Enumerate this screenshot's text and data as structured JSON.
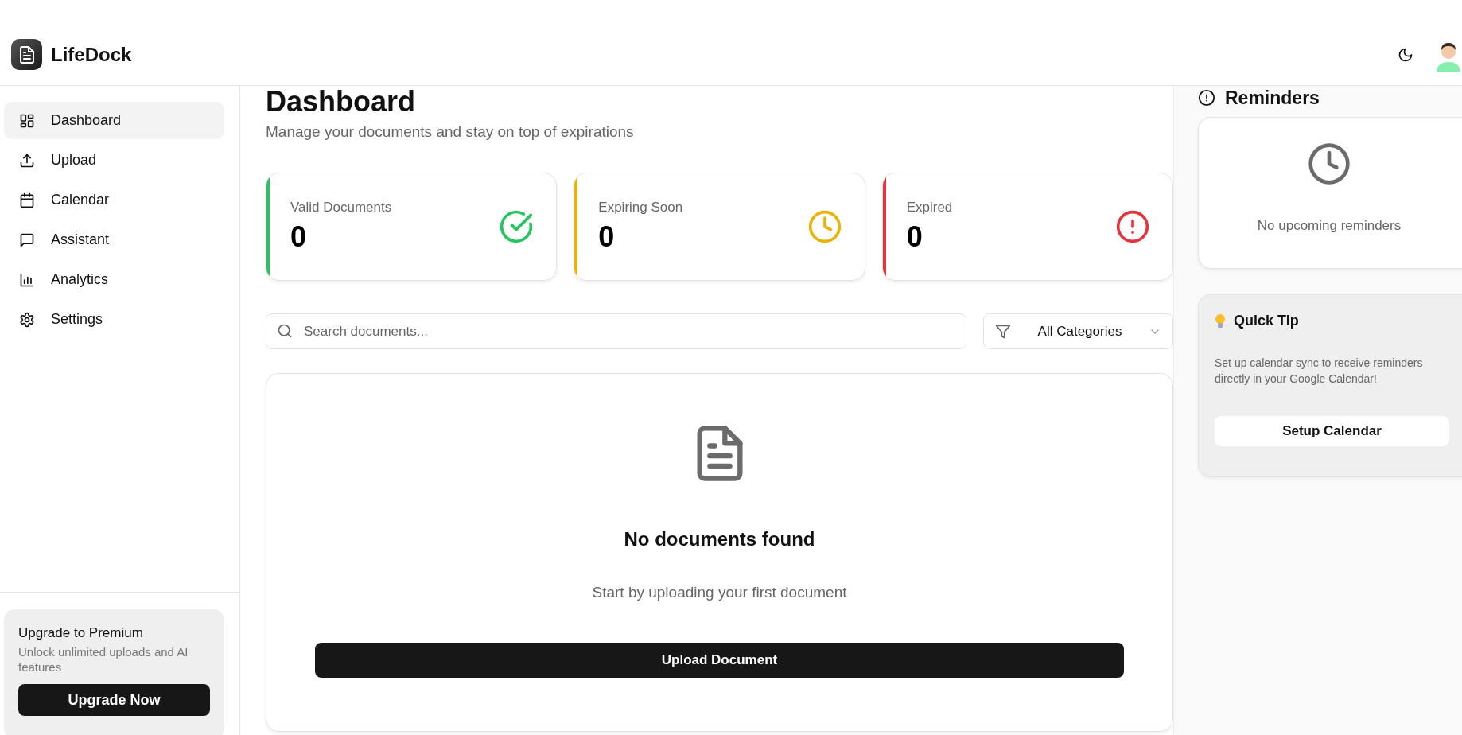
{
  "app": {
    "name": "LifeDock"
  },
  "sidebar": {
    "items": [
      {
        "label": "Dashboard",
        "kind": "grid",
        "selected": true
      },
      {
        "label": "Upload",
        "kind": "upload",
        "selected": false
      },
      {
        "label": "Calendar",
        "kind": "calendar",
        "selected": false
      },
      {
        "label": "Assistant",
        "kind": "chat",
        "selected": false
      },
      {
        "label": "Analytics",
        "kind": "chart",
        "selected": false
      },
      {
        "label": "Settings",
        "kind": "gear",
        "selected": false
      }
    ],
    "premium": {
      "title": "Upgrade to Premium",
      "text": "Unlock unlimited uploads and AI features",
      "button": "Upgrade Now"
    }
  },
  "page": {
    "title": "Dashboard",
    "subtitle": "Manage your documents and stay on top of expirations"
  },
  "stats": [
    {
      "label": "Valid Documents",
      "value": "0",
      "kind": "check",
      "color": "#22c55e"
    },
    {
      "label": "Expiring Soon",
      "value": "0",
      "kind": "clock",
      "color": "#eab308"
    },
    {
      "label": "Expired",
      "value": "0",
      "kind": "alert",
      "color": "#e5343d"
    }
  ],
  "search": {
    "placeholder": "Search documents..."
  },
  "category_filter": {
    "value": "All Categories"
  },
  "empty_state": {
    "title": "No documents found",
    "text": "Start by uploading your first document",
    "button": "Upload Document"
  },
  "reminders": {
    "title": "Reminders",
    "empty_text": "No upcoming reminders"
  },
  "quick_tip": {
    "title": "Quick Tip",
    "text": "Set up calendar sync to receive reminders directly in your Google Calendar!",
    "button": "Setup Calendar"
  }
}
